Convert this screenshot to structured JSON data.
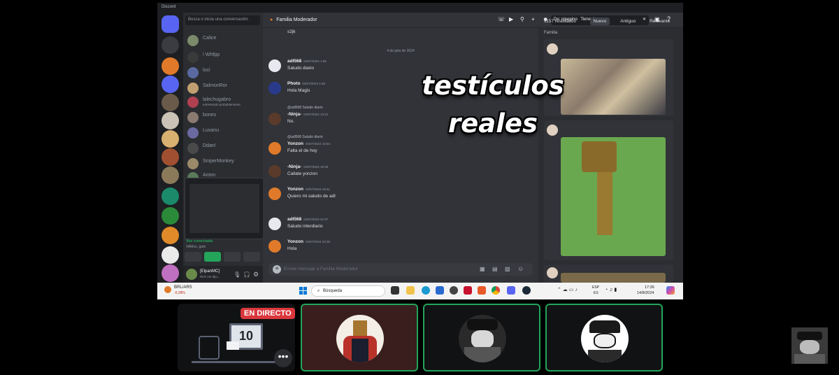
{
  "window": {
    "title": "Discord"
  },
  "channel_list": {
    "search_placeholder": "Busca o inicia una conversación",
    "dms": [
      {
        "name": "Calice"
      },
      {
        "name": "! Whfpp"
      },
      {
        "name": "luci"
      },
      {
        "name": "SalmonRor"
      },
      {
        "name": "lalechugabro",
        "status": "entretenido probablemente"
      },
      {
        "name": "bones"
      },
      {
        "name": "Luxanu"
      },
      {
        "name": "Ddan!"
      },
      {
        "name": "SniperMonkey"
      },
      {
        "name": "Anton"
      }
    ],
    "voice_status": "Voz conectada",
    "voice_sub": "VAMos, gato",
    "user": {
      "name": "[ElpanMC]",
      "status": "Rich me dijo..."
    }
  },
  "chat": {
    "channel_name": "Familia Moderador",
    "date_divider": "4 de julio de 2024",
    "top_text": "s2jk",
    "messages": [
      {
        "author": "adl568",
        "time": "04/07/2024 1:58",
        "text": "Saludo diario"
      },
      {
        "author": "Photo",
        "time": "04/07/2024 1:59",
        "text": "Hola Magis"
      },
      {
        "author": "-Ninja-",
        "time": "04/07/2024 13:21",
        "text": "No.",
        "reply": "@adl568 Saludo diario"
      },
      {
        "author": "Yonzon",
        "time": "04/07/2024 15:54",
        "text": "Falta el de hoy",
        "reply": "@adl568 Saludo diario"
      },
      {
        "author": "-Ninja-",
        "time": "04/07/2024 16:35",
        "text": "Callate yonzon"
      },
      {
        "author": "Yonzon",
        "time": "04/07/2024 18:41",
        "text": "Quiero mi saludo de adl"
      },
      {
        "author": "adl568",
        "time": "04/07/2024 22:37",
        "text": "Saludo interdiario"
      },
      {
        "author": "Yonzon",
        "time": "04/07/2024 22:39",
        "text": "Hola"
      }
    ],
    "composer_placeholder": "Enviar mensaje a Familia Moderador"
  },
  "search": {
    "query_from": "De: pipepino",
    "query_has": "Tiene: imagen",
    "results_count": "1157 resultados",
    "tabs": [
      "Nuevo",
      "Antiguo",
      "Relevante"
    ],
    "group_label": "Familia"
  },
  "overlay_caption": {
    "line1": "testículos",
    "line2": "reales"
  },
  "taskbar": {
    "ticker": "BRL/ARS",
    "ticker_change": "-0,28%",
    "search": "Búsqueda",
    "lang": "ESP",
    "lang2": "ES",
    "time": "17:36",
    "date": "14/8/2024"
  },
  "call": {
    "live_badge": "EN DIRECTO",
    "screen_number": "10",
    "more": "•••"
  },
  "colors": {
    "accent": "#5865f2",
    "live": "#da373c",
    "speaking": "#23a55a"
  }
}
